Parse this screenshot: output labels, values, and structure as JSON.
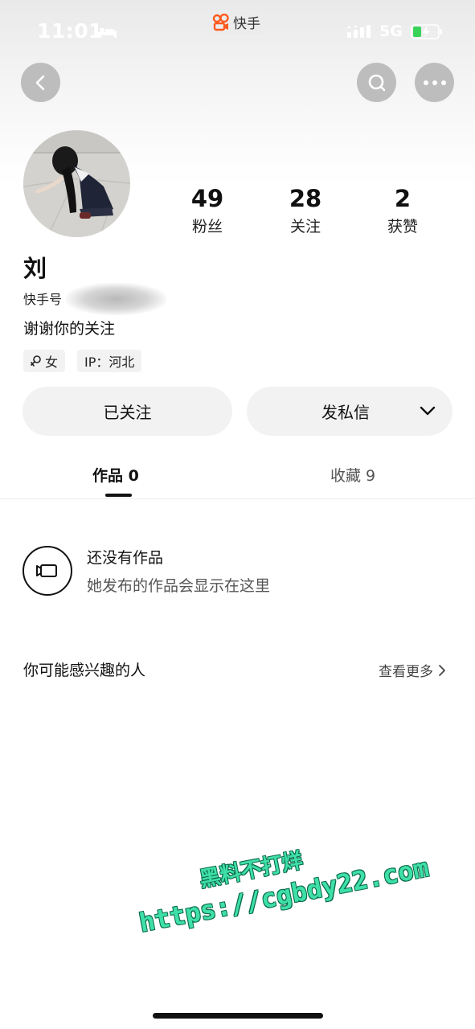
{
  "status_bar": {
    "time": "11:01",
    "app_name": "快手",
    "network": "5G"
  },
  "profile": {
    "name": "刘",
    "id_label": "快手号",
    "bio": "谢谢你的关注",
    "stats": [
      {
        "value": "49",
        "label": "粉丝"
      },
      {
        "value": "28",
        "label": "关注"
      },
      {
        "value": "2",
        "label": "获赞"
      }
    ],
    "tags": {
      "gender": "女",
      "ip": "IP：河北"
    }
  },
  "actions": {
    "following": "已关注",
    "message": "发私信"
  },
  "tabs": {
    "works": "作品 0",
    "favorites": "收藏 9"
  },
  "empty_state": {
    "title": "还没有作品",
    "subtitle": "她发布的作品会显示在这里"
  },
  "suggestions": {
    "title": "你可能感兴趣的人",
    "see_more": "查看更多"
  },
  "watermark": {
    "line1": "黑料不打烊",
    "line2": "https://cgbdy22.com"
  },
  "colors": {
    "watermark_green": "#3fe0a8",
    "nav_button_gray": "#bdbdbd",
    "chip_bg": "#f2f2f2"
  }
}
